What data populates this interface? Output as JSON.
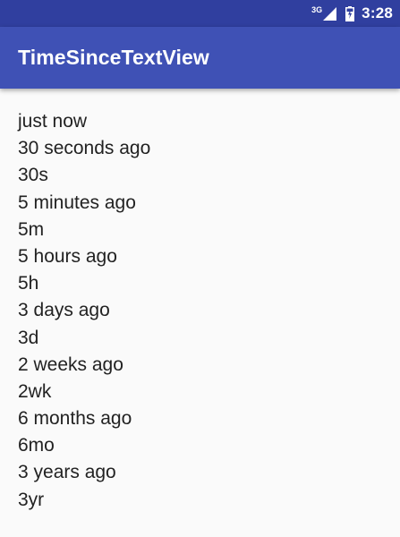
{
  "status_bar": {
    "network_type": "3G",
    "time": "3:28",
    "icons": [
      "signal-icon",
      "battery-icon"
    ],
    "background_color": "#303f9f"
  },
  "app_bar": {
    "title": "TimeSinceTextView",
    "background_color": "#3f51b5"
  },
  "items": [
    "just now",
    "30 seconds ago",
    "30s",
    "5 minutes ago",
    "5m",
    "5 hours ago",
    "5h",
    "3 days ago",
    "3d",
    "2 weeks ago",
    "2wk",
    "6 months ago",
    "6mo",
    "3 years ago",
    "3yr"
  ]
}
